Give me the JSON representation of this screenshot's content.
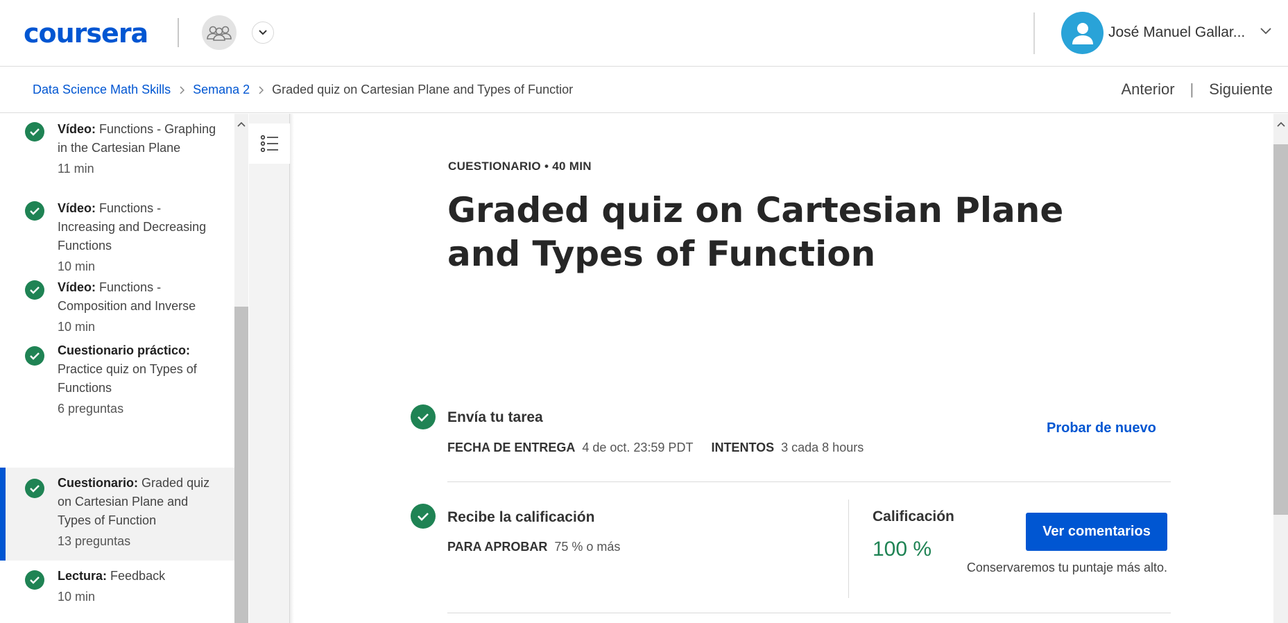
{
  "header": {
    "logo_text": "coursera",
    "user_name": "José Manuel Gallar..."
  },
  "breadcrumb": {
    "items": [
      "Data Science Math Skills",
      "Semana 2"
    ],
    "current": "Graded quiz on Cartesian Plane and Types of Functior",
    "prev_label": "Anterior",
    "next_label": "Siguiente"
  },
  "sidebar": {
    "items": [
      {
        "type": "Vídeo:",
        "title": "Functions - Graphing in the Cartesian Plane",
        "meta": "11 min"
      },
      {
        "type": "Vídeo:",
        "title": "Functions - Increasing and Decreasing Functions",
        "meta": "10 min"
      },
      {
        "type": "Vídeo:",
        "title": "Functions - Composition and Inverse",
        "meta": "10 min"
      },
      {
        "type": "Cuestionario práctico:",
        "title": "Practice quiz on Types of Functions",
        "meta": "6 preguntas"
      },
      {
        "type": "Cuestionario:",
        "title": "Graded quiz on Cartesian Plane and Types of Function",
        "meta": "13 preguntas"
      },
      {
        "type": "Lectura:",
        "title": "Feedback",
        "meta": "10 min"
      }
    ]
  },
  "main": {
    "kicker": "CUESTIONARIO • 40 MIN",
    "title": "Graded quiz on Cartesian Plane and Types of Function",
    "submit": {
      "title": "Envía tu tarea",
      "due_label": "FECHA DE ENTREGA",
      "due_value": "4 de oct. 23:59 PDT",
      "attempts_label": "INTENTOS",
      "attempts_value": "3 cada 8 hours",
      "try_again": "Probar de nuevo"
    },
    "grade": {
      "title": "Recibe la calificación",
      "pass_label": "PARA APROBAR",
      "pass_value": "75 % o más",
      "grade_label": "Calificación",
      "grade_value": "100 %",
      "feedback_button": "Ver comentarios",
      "keep_note": "Conservaremos tu puntaje más alto."
    }
  },
  "colors": {
    "brand": "#0056d2",
    "success": "#1f8354",
    "avatar": "#29a3d8"
  },
  "icons": [
    "users-group-icon",
    "chevron-down-icon",
    "user-avatar-icon",
    "chevron-right-icon",
    "check-circle-icon",
    "list-outline-icon"
  ]
}
